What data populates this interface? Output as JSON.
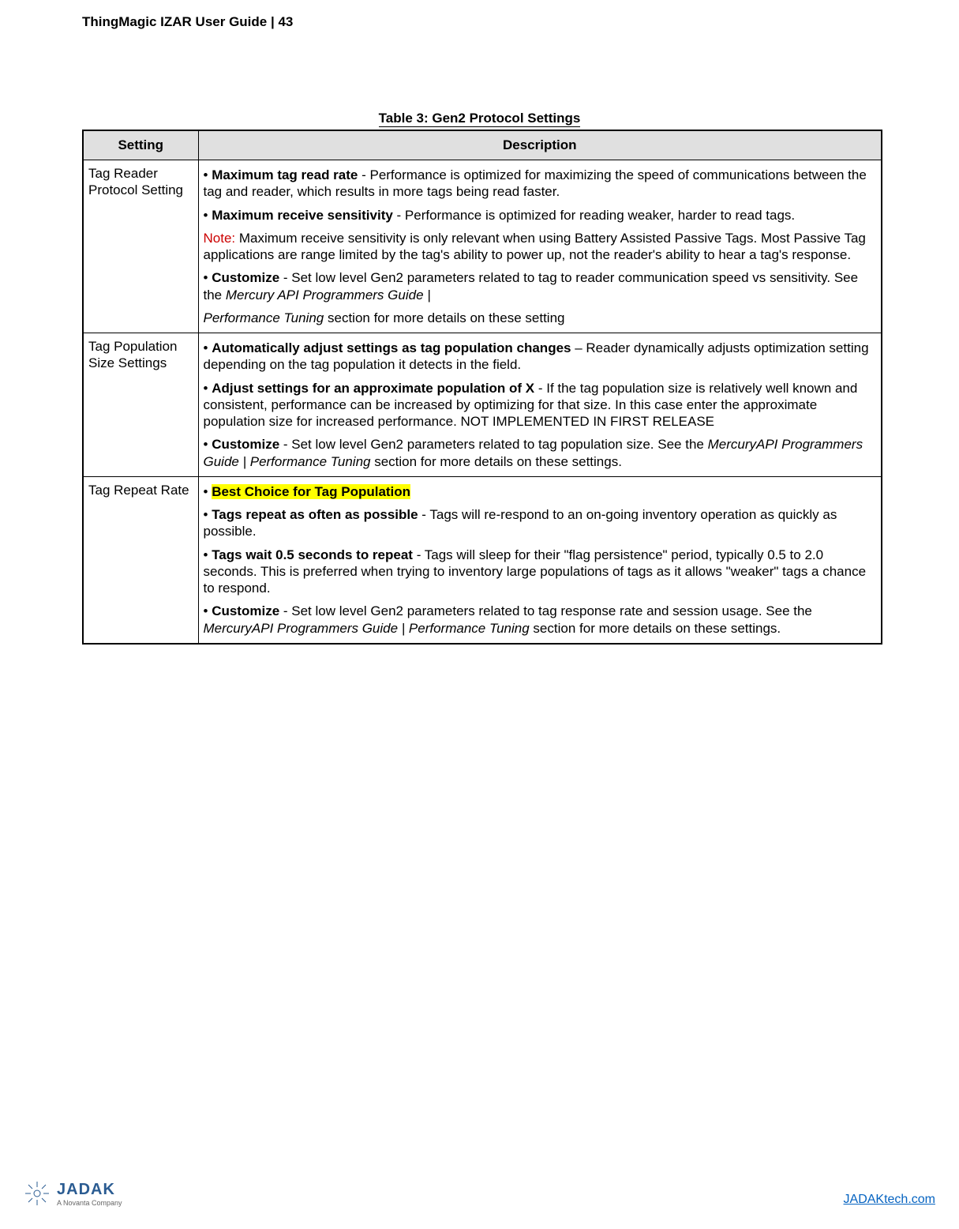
{
  "header": {
    "title": "ThingMagic IZAR User Guide | 43"
  },
  "table": {
    "caption": "Table 3: Gen2 Protocol Settings",
    "headers": {
      "setting": "Setting",
      "description": "Description"
    },
    "rows": [
      {
        "setting": "Tag Reader Protocol Setting",
        "desc": {
          "p1_bullet": "• ",
          "p1_bold": "Maximum tag read rate",
          "p1_rest": " - Performance is optimized for maximizing the speed of communications between the tag and reader, which results in more tags being read faster.",
          "p2_bullet": "• ",
          "p2_bold": "Maximum receive sensitivity",
          "p2_rest": " - Performance is optimized for reading weaker, harder to read tags.",
          "p3_note": "Note:",
          "p3_rest": " Maximum receive sensitivity is only relevant when using Battery Assisted Passive Tags. Most Passive Tag applications are range limited by the tag's ability to power up, not the reader's ability to hear a tag's response.",
          "p4_bullet": "• ",
          "p4_bold": "Customize",
          "p4_rest1": " - Set low level Gen2 parameters related to tag to reader communication speed vs sensitivity. See the ",
          "p4_italic": "Mercury API Programmers Guide |",
          "p5_italic": "Performance Tuning",
          "p5_rest": " section for more details on these setting"
        }
      },
      {
        "setting": "Tag Population Size Settings",
        "desc": {
          "p1_bullet": "• ",
          "p1_bold": "Automatically adjust settings as tag population changes",
          "p1_rest": " – Reader dynamically adjusts optimization setting depending on the tag population it detects in the field.",
          "p2_bullet": "• ",
          "p2_bold": "Adjust settings for an approximate population of X",
          "p2_rest": " - If the tag population size is relatively well known and consistent, performance can be increased by optimizing for that size. In this case enter the approximate population size for increased performance. NOT IMPLEMENTED IN FIRST RELEASE",
          "p3_bullet": "• ",
          "p3_bold": "Customize",
          "p3_rest1": " - Set low level Gen2 parameters related to tag population size. See the ",
          "p3_italic": "MercuryAPI Programmers Guide | Performance Tuning",
          "p3_rest2": " section for more details on these settings."
        }
      },
      {
        "setting": "Tag Repeat Rate",
        "desc": {
          "p1_bullet": "• ",
          "p1_hl": "Best Choice for Tag Population",
          "p2_bullet": "• ",
          "p2_bold": "Tags repeat as often as possible",
          "p2_rest": " - Tags will re-respond to an on-going inventory operation as quickly as possible.",
          "p3_bullet": "• ",
          "p3_bold": "Tags wait 0.5 seconds to repeat",
          "p3_rest": " - Tags will sleep for their \"flag persistence\" period, typically 0.5 to 2.0 seconds. This is preferred when trying to inventory large populations of tags as it allows \"weaker\" tags a chance to respond.",
          "p4_bullet": "• ",
          "p4_bold": "Customize",
          "p4_rest1": " - Set low level Gen2 parameters related to tag response rate and session usage. See the ",
          "p4_italic": "MercuryAPI Programmers Guide | Performance Tuning",
          "p4_rest2": " section for more details on these settings."
        }
      }
    ]
  },
  "footer": {
    "logo_main": "JADAK",
    "logo_sub": "A Novanta Company",
    "link": "JADAKtech.com"
  }
}
